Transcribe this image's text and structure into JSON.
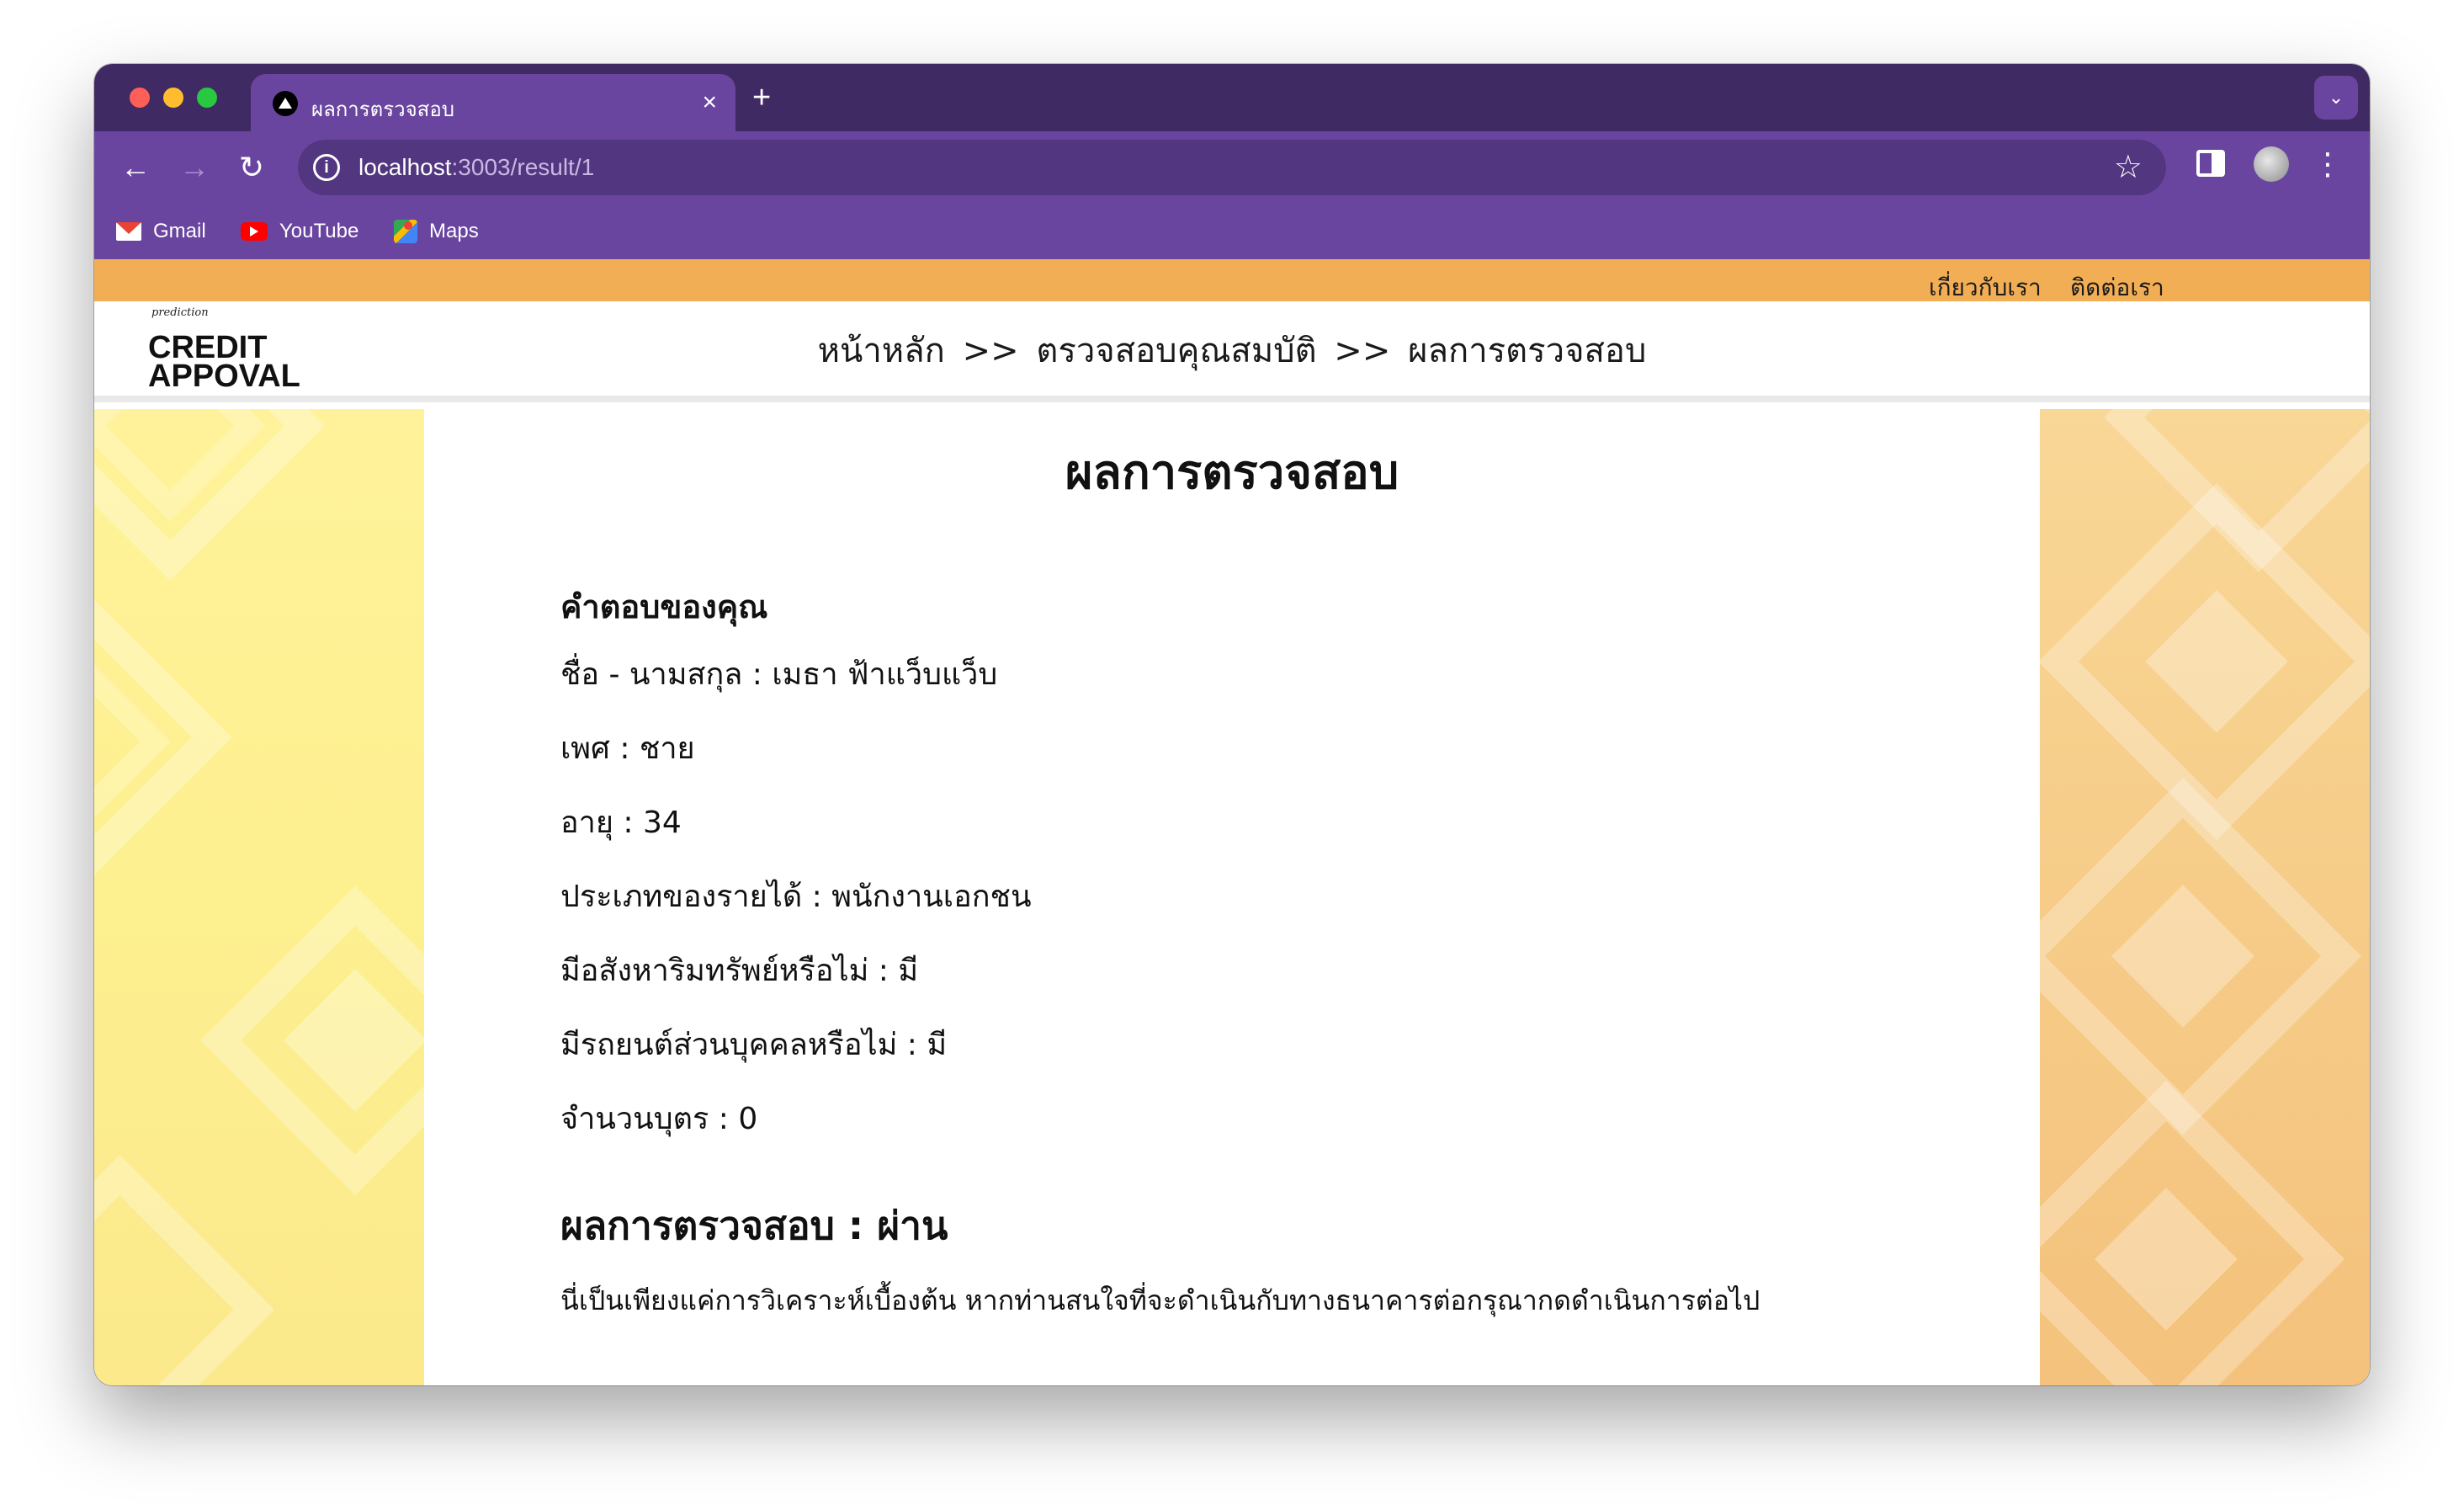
{
  "browser": {
    "tab_title": "ผลการตรวจสอบ",
    "tab_close": "×",
    "new_tab": "+",
    "url_host": "localhost",
    "url_rest": ":3003/result/1",
    "bookmarks": [
      {
        "label": "Gmail",
        "icon": "gmail-icon"
      },
      {
        "label": "YouTube",
        "icon": "youtube-icon"
      },
      {
        "label": "Maps",
        "icon": "maps-icon"
      }
    ]
  },
  "site": {
    "top_links": {
      "about": "เกี่ยวกับเรา",
      "contact": "ติดต่อเรา"
    },
    "logo": {
      "script": "prediction",
      "line1": "CREDIT",
      "line2": "APPOVAL"
    },
    "breadcrumb": {
      "home": "หน้าหลัก",
      "sep1": ">>",
      "check": "ตรวจสอบคุณสมบัติ",
      "sep2": ">>",
      "result": "ผลการตรวจสอบ"
    },
    "accent_color": "#f2ae55"
  },
  "result": {
    "title": "ผลการตรวจสอบ",
    "answers_heading": "คำตอบของคุณ",
    "answers": [
      "ชื่อ - นามสกุล : เมธา ฟ้าแว็บแว็บ",
      "เพศ : ชาย",
      "อายุ : 34",
      "ประเภทของรายได้ : พนักงานเอกชน",
      "มีอสังหาริมทรัพย์หรือไม่ : มี",
      "มีรถยนต์ส่วนบุคคลหรือไม่ : มี",
      "จำนวนบุตร : 0"
    ],
    "outcome": "ผลการตรวจสอบ : ผ่าน",
    "disclaimer": "นี่เป็นเพียงแค่การวิเคราะห์เบื้องต้น หากท่านสนใจที่จะดำเนินกับทางธนาคารต่อกรุณากดดำเนินการต่อไป"
  }
}
